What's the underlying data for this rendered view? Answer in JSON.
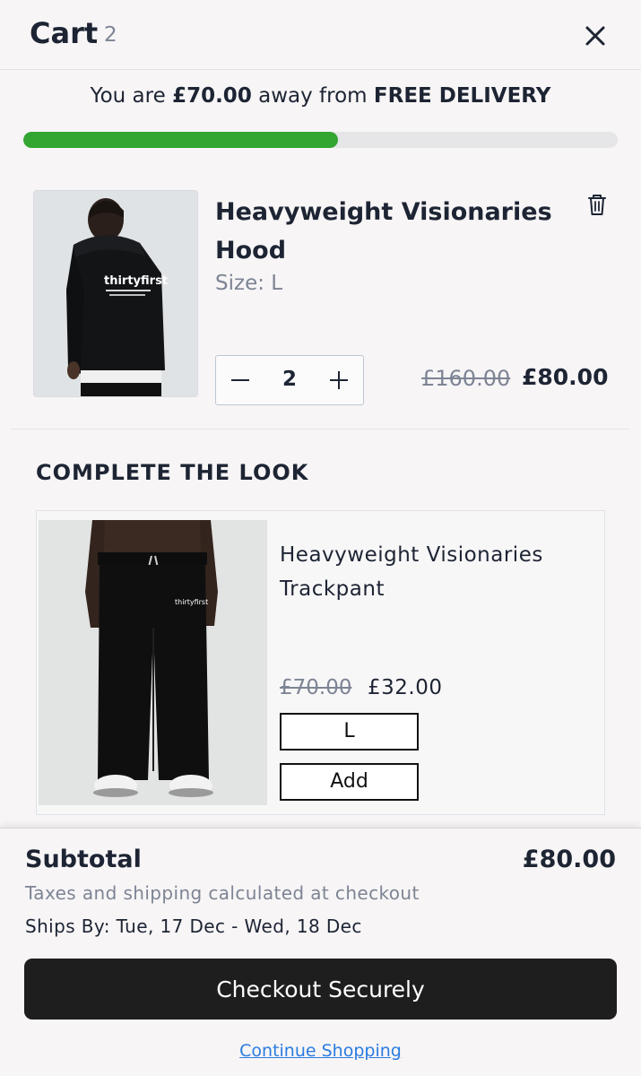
{
  "header": {
    "title": "Cart",
    "count": "2"
  },
  "delivery": {
    "prefix": "You are ",
    "amount": "£70.00",
    "middle": " away from ",
    "goal": "FREE DELIVERY",
    "progress_fraction": 0.53,
    "progress_color": "#33a531"
  },
  "cart_item": {
    "name": "Heavyweight Visionaries Hood",
    "size": "Size: L",
    "quantity": "2",
    "old_price": "£160.00",
    "price": "£80.00",
    "image_logo": "thirtyfirst"
  },
  "complete_the_look": {
    "heading": "COMPLETE THE LOOK",
    "product": {
      "name": "Heavyweight Visionaries Trackpant",
      "old_price": "£70.00",
      "price": "£32.00",
      "size_option": "L",
      "add_label": "Add",
      "image_logo": "thirtyfirst"
    }
  },
  "footer": {
    "subtotal_label": "Subtotal",
    "subtotal_value": "£80.00",
    "taxes_note": "Taxes and shipping calculated at checkout",
    "ships_by": "Ships By: Tue, 17 Dec - Wed, 18 Dec",
    "checkout_label": "Checkout Securely",
    "continue_label": "Continue Shopping"
  },
  "icons": {
    "close": "close-icon",
    "trash": "trash-icon",
    "minus": "minus-icon",
    "plus": "plus-icon"
  }
}
